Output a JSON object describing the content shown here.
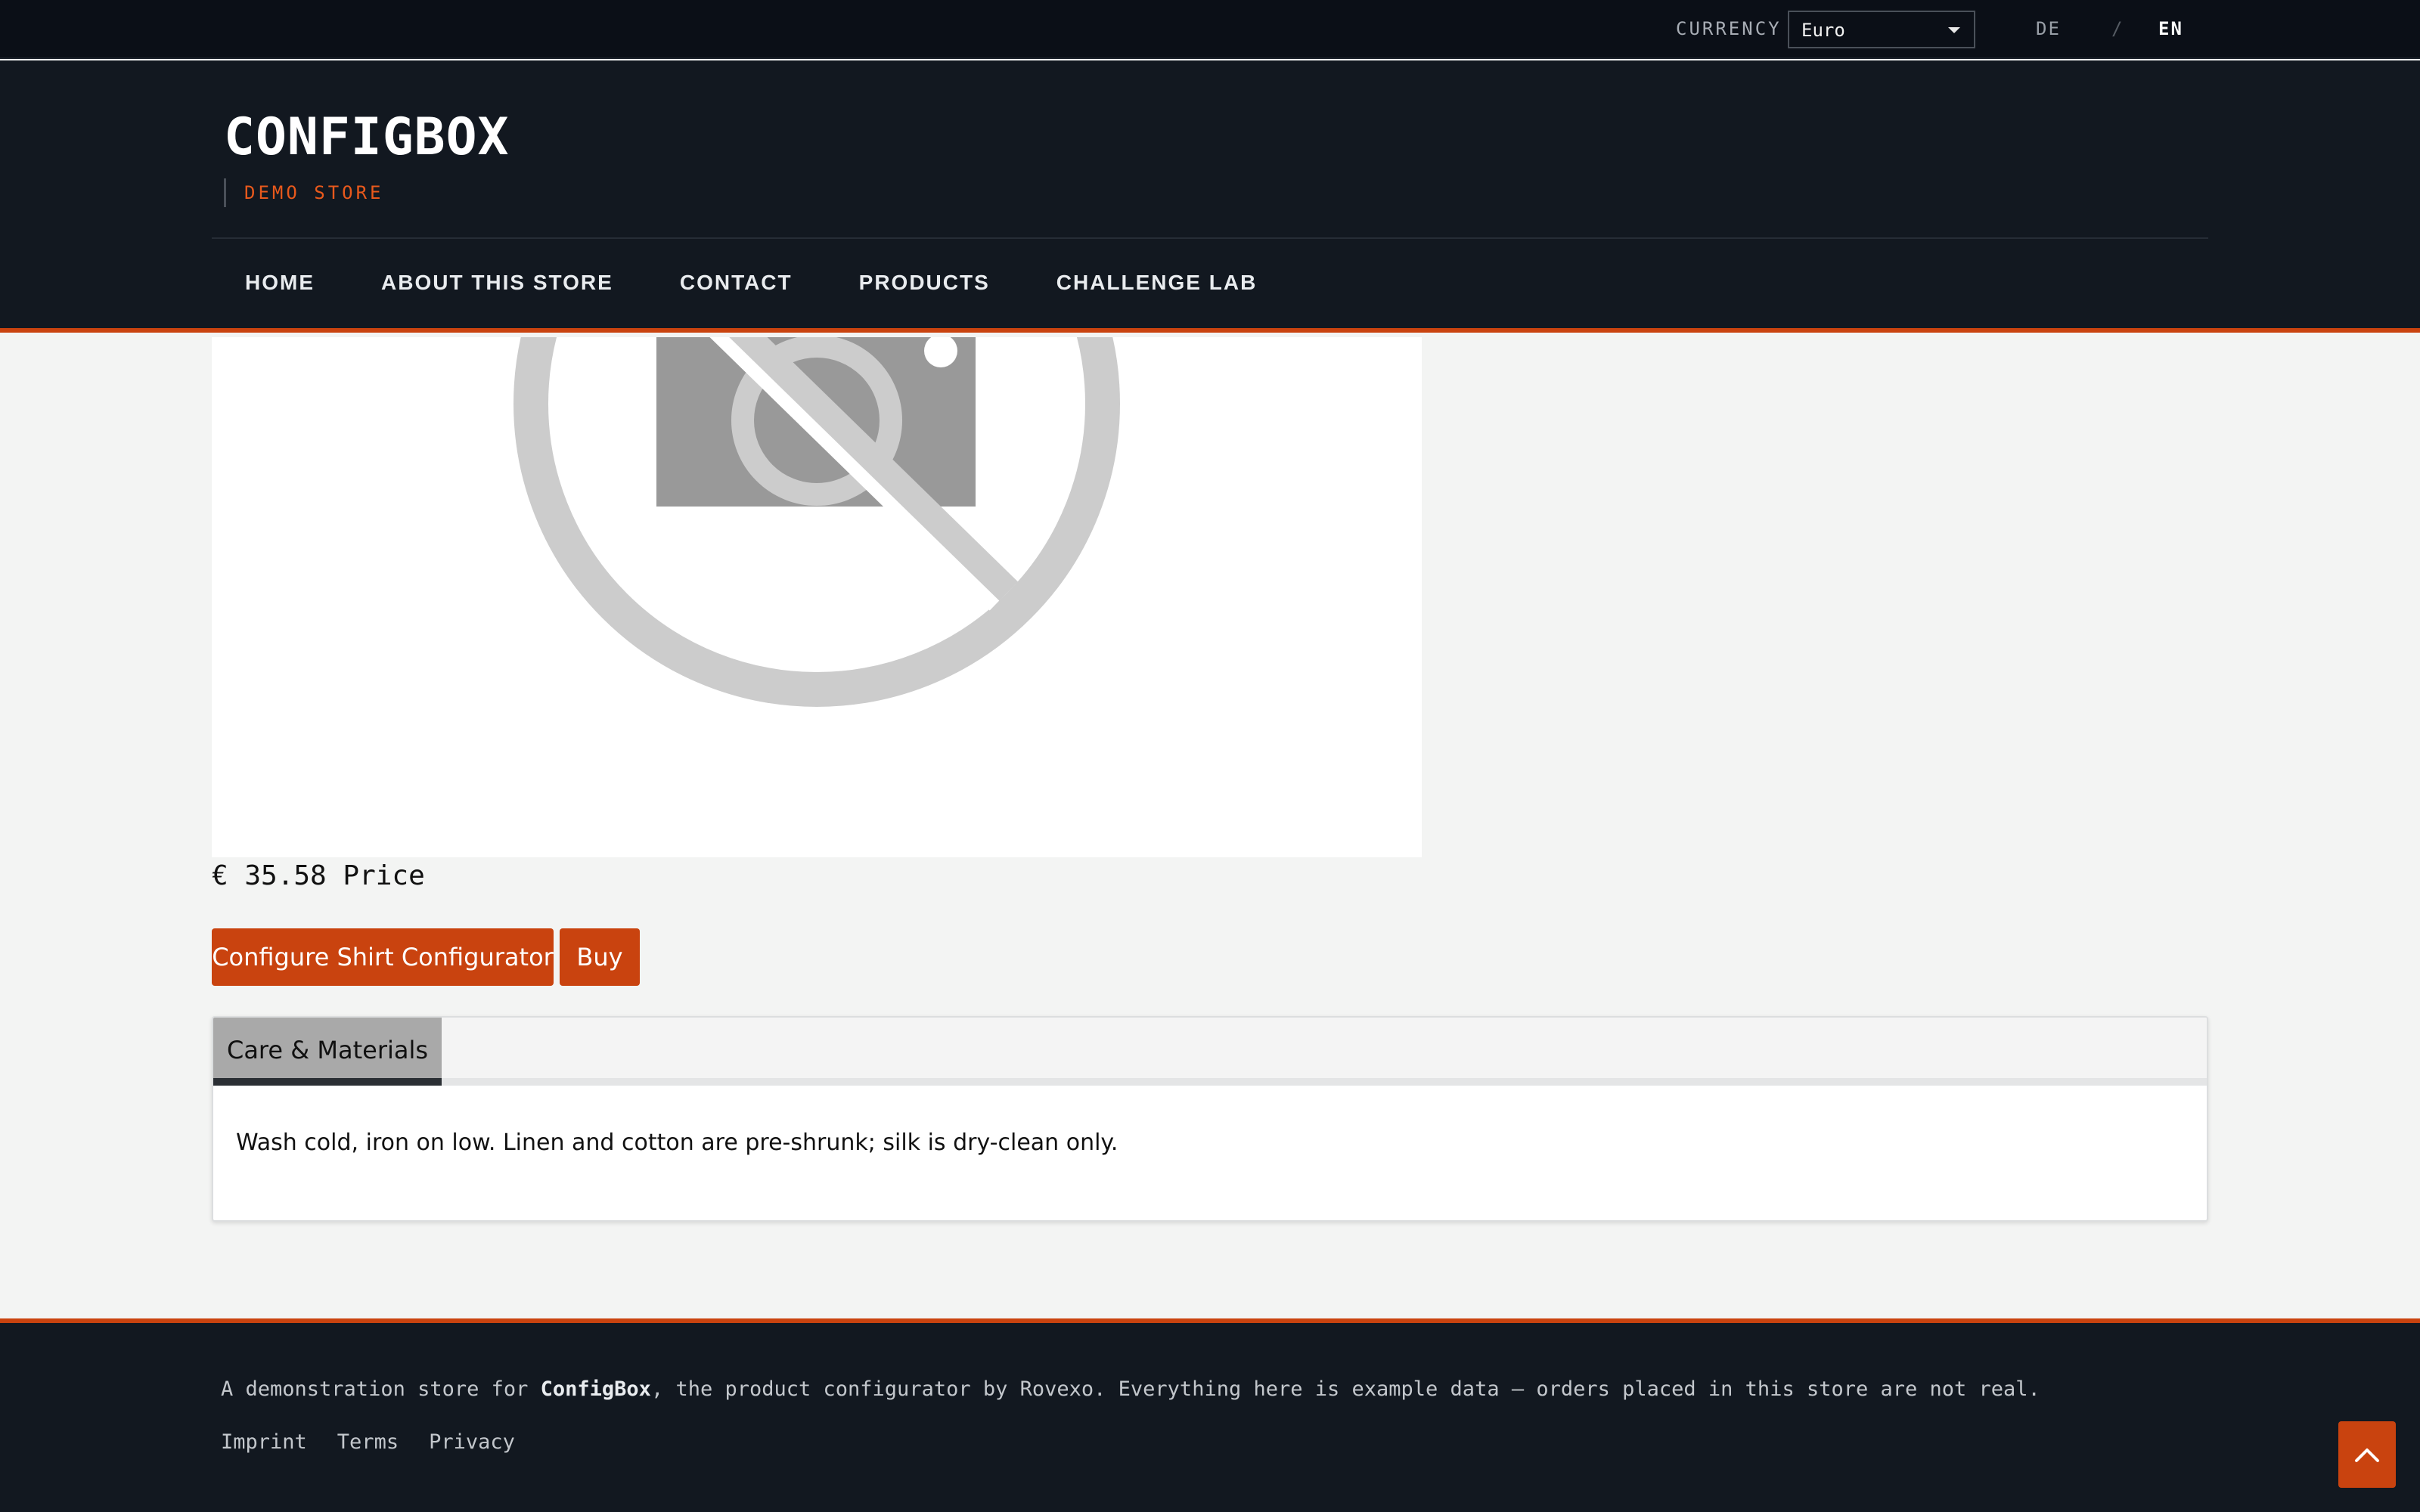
{
  "topbar": {
    "currency_label": "CURRENCY",
    "currency_value": "Euro",
    "lang_de": "DE",
    "lang_separator": "/",
    "lang_en": "EN"
  },
  "header": {
    "logo": "CONFIGBOX",
    "tagline": "DEMO STORE",
    "nav": [
      "HOME",
      "ABOUT THIS STORE",
      "CONTACT",
      "PRODUCTS",
      "CHALLENGE LAB"
    ]
  },
  "product": {
    "price": "€ 35.58 Price",
    "configure_label": "Configure Shirt Configurator",
    "buy_label": "Buy"
  },
  "tabs": {
    "active_label": "Care & Materials",
    "content": "Wash cold, iron on low. Linen and cotton are pre-shrunk; silk is dry-clean only."
  },
  "footer": {
    "text_before": "A demonstration store for ",
    "brand": "ConfigBox",
    "text_after": ", the product configurator by Rovexo. Everything here is example data — orders placed in this store are not real.",
    "links": [
      "Imprint",
      "Terms",
      "Privacy"
    ]
  },
  "colors": {
    "accent": "#c9430f",
    "header_bg": "#121820",
    "topbar_bg": "#0b0f17",
    "page_bg": "#f3f4f3"
  },
  "icons": {
    "product_image": "no-image-icon",
    "dropdown": "chevron-down-icon",
    "scroll_top": "chevron-up-icon"
  }
}
